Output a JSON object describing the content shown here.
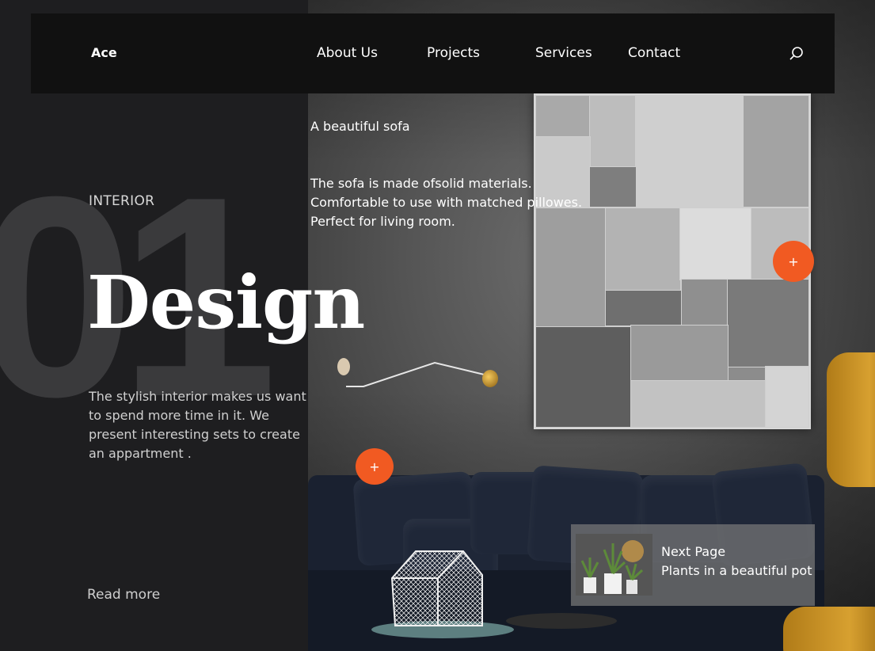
{
  "brand": {
    "logo": "Ace"
  },
  "nav": {
    "items": [
      {
        "label": "About Us"
      },
      {
        "label": "Projects"
      },
      {
        "label": "Services"
      },
      {
        "label": "Contact"
      }
    ],
    "search_icon": "search-icon"
  },
  "hero": {
    "number": "01",
    "category": "INTERIOR",
    "headline": "Design",
    "description": "The stylish interior makes us want to spend more time in it. We present interesting sets to create an appartment .",
    "read_more": "Read more"
  },
  "product": {
    "title": "A beautiful sofa",
    "description": "The sofa is made ofsolid materials. Comfortable to use with matched pillowes. Perfect for living room."
  },
  "hotspots": [
    {
      "label": "+"
    },
    {
      "label": "+"
    }
  ],
  "next_page": {
    "title": "Next Page",
    "subtitle": "Plants in a beautiful pot"
  },
  "colors": {
    "accent": "#f15a22",
    "header_bg": "#111111",
    "panel_bg": "#1e1e20"
  }
}
